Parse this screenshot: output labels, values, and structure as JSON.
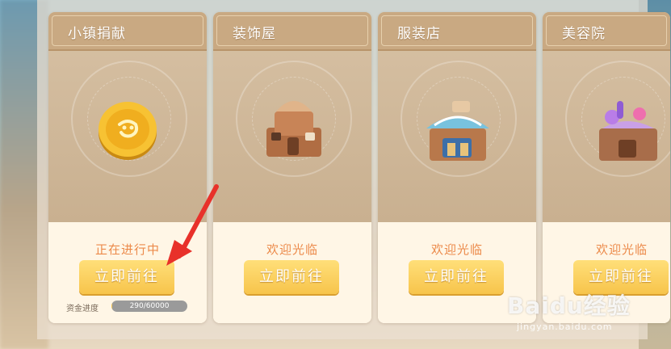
{
  "cards": [
    {
      "title": "小镇捐献",
      "status": "正在进行中",
      "button": "立即前往",
      "icon": "gold-coin-icon",
      "progress": {
        "label": "资金进度",
        "text": "290/60000",
        "value": 290,
        "max": 60000
      }
    },
    {
      "title": "装饰屋",
      "status": "欢迎光临",
      "button": "立即前往",
      "icon": "decoration-house-icon"
    },
    {
      "title": "服装店",
      "status": "欢迎光临",
      "button": "立即前往",
      "icon": "clothing-store-icon"
    },
    {
      "title": "美容院",
      "status": "欢迎光临",
      "button": "立即前往",
      "icon": "beauty-salon-icon"
    }
  ],
  "watermark": {
    "brand": "Baidu经验",
    "url": "jingyan.baidu.com"
  },
  "colors": {
    "status": "#ec8a4a",
    "button": "#f7c44b",
    "header": "#c9a982",
    "arrow": "#e8312a"
  }
}
